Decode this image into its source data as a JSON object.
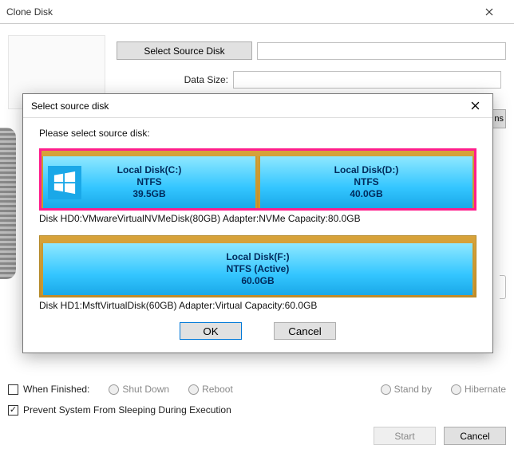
{
  "mainWindow": {
    "title": "Clone Disk",
    "selectSourceBtn": "Select Source Disk",
    "dataSizeLabel": "Data Size:",
    "optionsBtnFragment": "ns"
  },
  "bottom": {
    "whenFinishedLabel": "When Finished:",
    "radios": {
      "shutDown": "Shut Down",
      "reboot": "Reboot",
      "standBy": "Stand by",
      "hibernate": "Hibernate"
    },
    "preventSleep": "Prevent System From Sleeping During Execution",
    "start": "Start",
    "cancel": "Cancel"
  },
  "modal": {
    "title": "Select source disk",
    "prompt": "Please select source disk:",
    "ok": "OK",
    "cancel": "Cancel",
    "disks": [
      {
        "selected": true,
        "meta": "Disk HD0:VMwareVirtualNVMeDisk(80GB)  Adapter:NVMe  Capacity:80.0GB",
        "partitions": [
          {
            "name": "Local Disk(C:)",
            "fs": "NTFS",
            "size": "39.5GB",
            "hasWinLogo": true
          },
          {
            "name": "Local Disk(D:)",
            "fs": "NTFS",
            "size": "40.0GB",
            "hasWinLogo": false
          }
        ]
      },
      {
        "selected": false,
        "meta": "Disk HD1:MsftVirtualDisk(60GB)  Adapter:Virtual  Capacity:60.0GB",
        "partitions": [
          {
            "name": "Local Disk(F:)",
            "fs": "NTFS (Active)",
            "size": "60.0GB",
            "hasWinLogo": false
          }
        ]
      }
    ]
  }
}
